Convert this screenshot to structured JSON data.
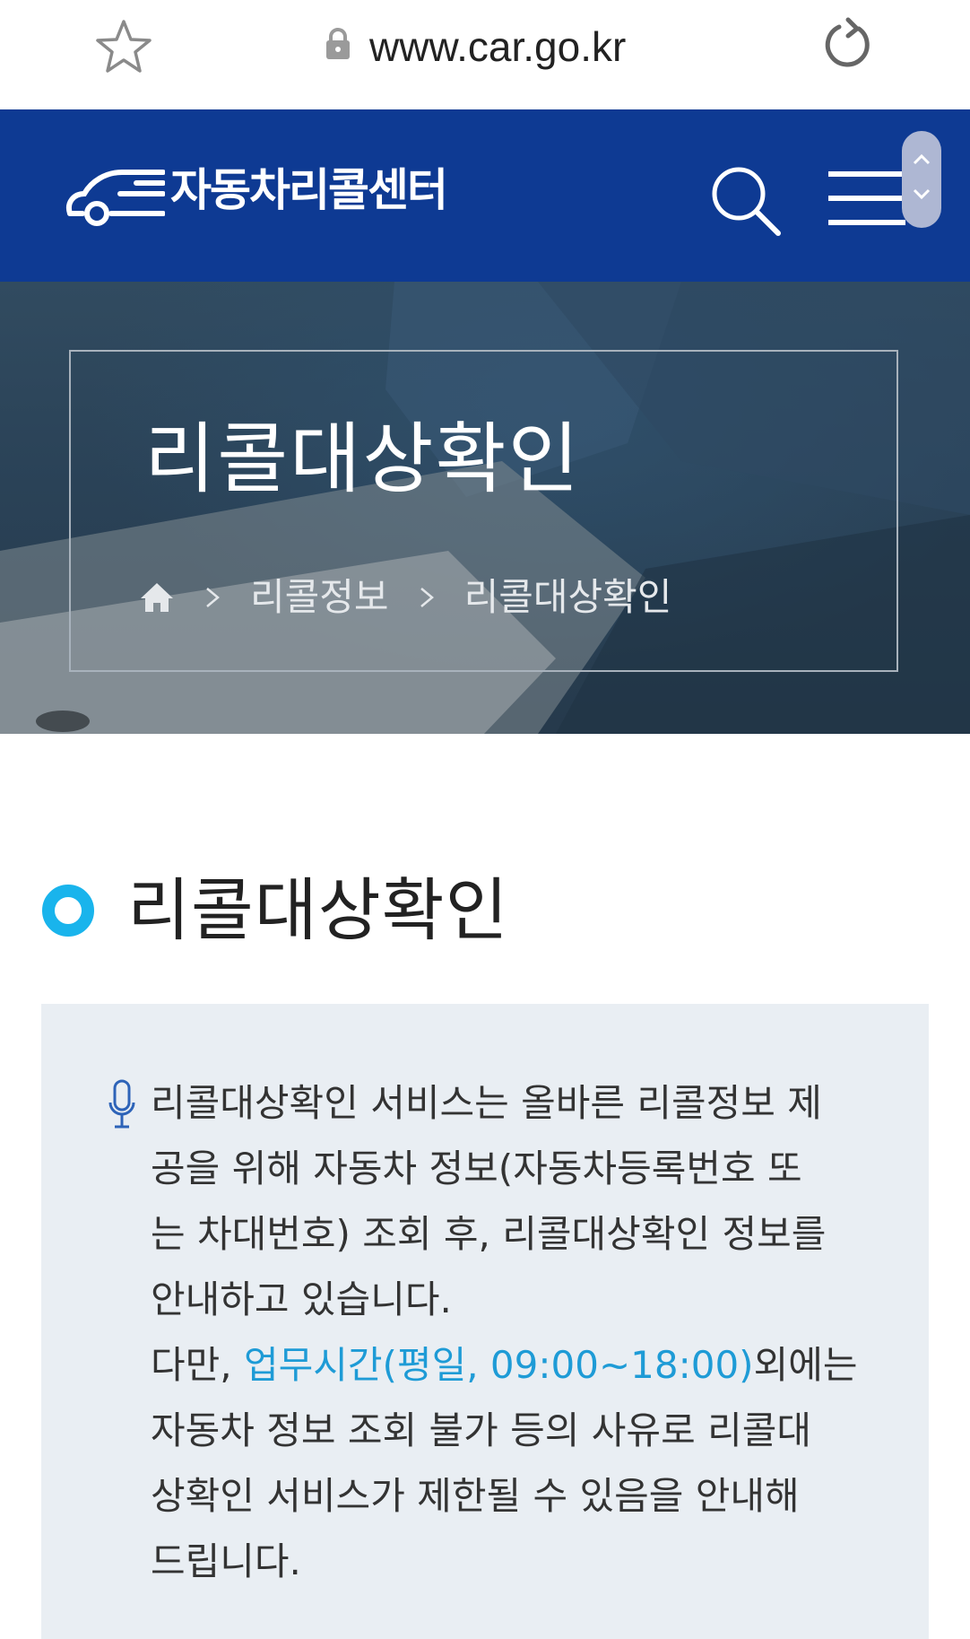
{
  "browser": {
    "url": "www.car.go.kr"
  },
  "header": {
    "logo_text": "자동차리콜센터"
  },
  "hero": {
    "title": "리콜대상확인",
    "breadcrumb": [
      "리콜정보",
      "리콜대상확인"
    ]
  },
  "section": {
    "title": "리콜대상확인"
  },
  "notice": {
    "lines": [
      "리콜대상확인 서비스는 올바른 리콜정보 제",
      "공을 위해 자동차 정보(자동차등록번호 또",
      "는 차대번호) 조회 후, 리콜대상확인 정보를",
      "안내하고 있습니다."
    ],
    "line5_before": "다만, ",
    "line5_highlight": "업무시간(평일, 09:00~18:00)",
    "line5_after": "외에는",
    "lines_after": [
      "자동차 정보 조회 불가 등의 사유로 리콜대",
      "상확인 서비스가 제한될 수 있음을 안내해",
      "드립니다."
    ]
  },
  "colors": {
    "header_bg": "#0e3a93",
    "accent": "#1e9bd6",
    "notice_bg": "#e9eef3"
  },
  "icons": [
    "star-icon",
    "lock-icon",
    "reload-icon",
    "car-logo-icon",
    "search-icon",
    "menu-icon",
    "home-icon",
    "chevron-right-icon",
    "ring-icon",
    "microphone-icon"
  ]
}
